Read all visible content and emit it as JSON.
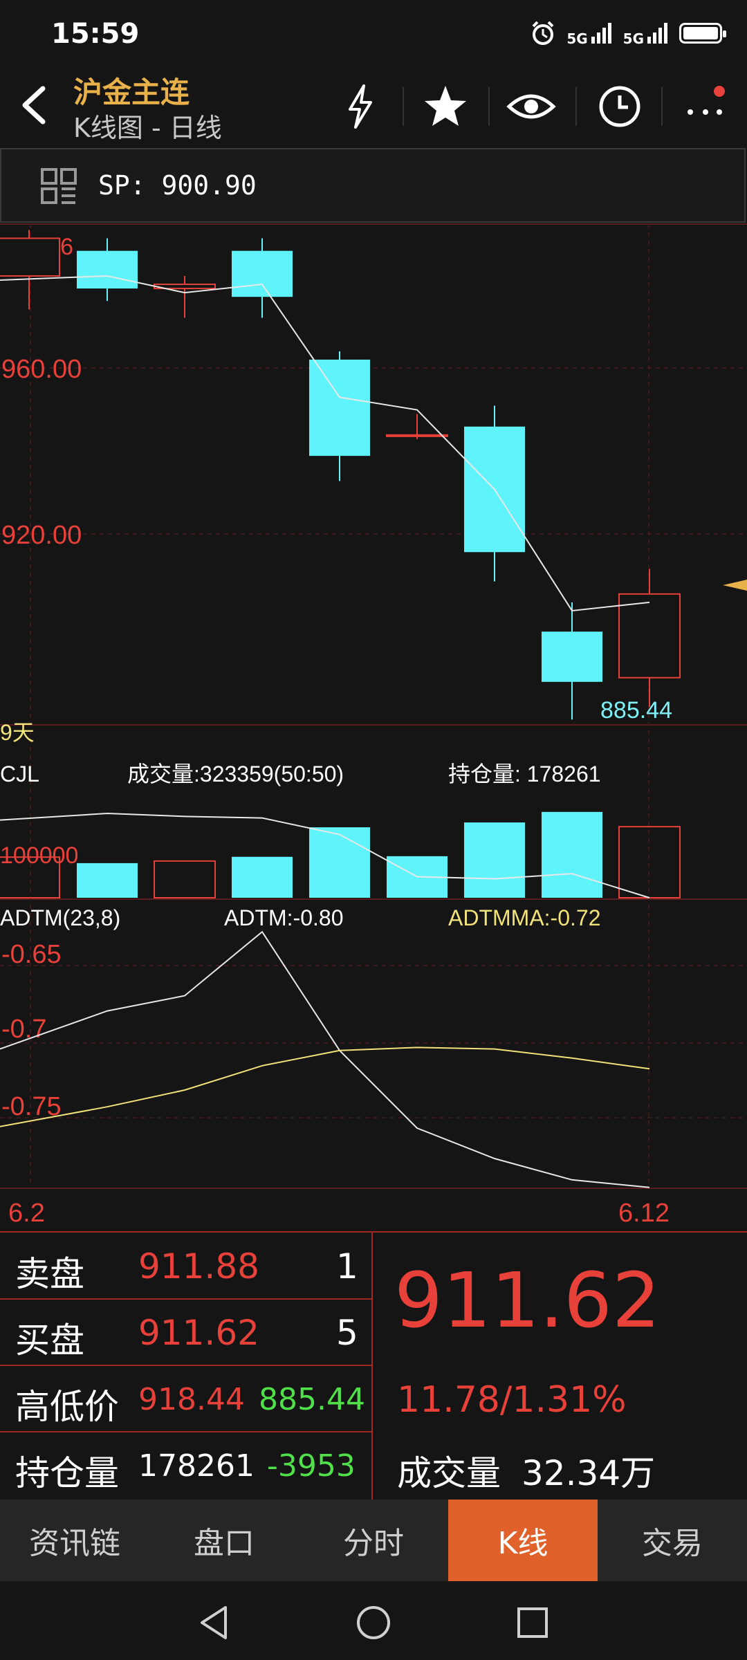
{
  "status_bar": {
    "time": "15:59",
    "signal1": "5G",
    "signal2": "5G"
  },
  "header": {
    "title": "沪金主连",
    "subtitle": "K线图 - 日线",
    "icons": [
      "back-icon",
      "lightning-icon",
      "star-icon",
      "eye-icon",
      "clock-icon",
      "more-icon"
    ]
  },
  "sp": {
    "label": "SP: 900.90"
  },
  "kline": {
    "y_labels": [
      "990.96",
      "960.00",
      "920.00"
    ],
    "low_label": "885.44",
    "period_label": "9天",
    "candles": [
      {
        "open": 981,
        "close": 990,
        "high": 992,
        "low": 973
      },
      {
        "open": 987,
        "close": 978,
        "high": 990,
        "low": 975
      },
      {
        "open": 978,
        "close": 979,
        "high": 981,
        "low": 971
      },
      {
        "open": 987,
        "close": 976,
        "high": 990,
        "low": 971
      },
      {
        "open": 961,
        "close": 938,
        "high": 963,
        "low": 932
      },
      {
        "open": 943,
        "close": 943,
        "high": 948,
        "low": 942
      },
      {
        "open": 945,
        "close": 915,
        "high": 950,
        "low": 908
      },
      {
        "open": 896,
        "close": 884,
        "high": 903,
        "low": 875
      },
      {
        "open": 885,
        "close": 905,
        "high": 911,
        "low": 878
      }
    ],
    "ma": [
      980,
      981,
      977,
      979,
      952,
      949,
      930,
      901,
      903
    ]
  },
  "volume": {
    "title": "CJL",
    "volume_text": "成交量:323359(50:50)",
    "oi_text": "持仓量: 178261",
    "scale_label": "100000",
    "bars": [
      {
        "v": 135000,
        "up": true
      },
      {
        "v": 115000,
        "up": false
      },
      {
        "v": 122000,
        "up": true
      },
      {
        "v": 136000,
        "up": false
      },
      {
        "v": 234000,
        "up": false
      },
      {
        "v": 138000,
        "up": false
      },
      {
        "v": 250000,
        "up": false
      },
      {
        "v": 285000,
        "up": false
      },
      {
        "v": 236000,
        "up": true
      }
    ],
    "oi_line": [
      258000,
      280000,
      270000,
      265000,
      210000,
      70000,
      63000,
      80000,
      0
    ]
  },
  "adtm": {
    "title": "ADTM(23,8)",
    "adtm_text": "ADTM:-0.80",
    "adtmma_text": "ADTMMA:-0.72",
    "y_labels": [
      "-0.65",
      "-0.7",
      "-0.75"
    ],
    "adtm": [
      -0.713,
      -0.688,
      -0.678,
      -0.636,
      -0.714,
      -0.765,
      -0.785,
      -0.799,
      -0.804
    ],
    "adtmma": [
      -0.764,
      -0.751,
      -0.74,
      -0.724,
      -0.714,
      -0.712,
      -0.713,
      -0.719,
      -0.726
    ]
  },
  "dates": {
    "start": "6.2",
    "end": "6.12"
  },
  "quote": {
    "sell_label": "卖盘",
    "sell_price": "911.88",
    "sell_qty": "1",
    "buy_label": "买盘",
    "buy_price": "911.62",
    "buy_qty": "5",
    "hl_label": "高低价",
    "high": "918.44",
    "low": "885.44",
    "oi_label": "持仓量",
    "oi_value": "178261",
    "oi_change": "-3953",
    "last_price": "911.62",
    "change": "11.78/1.31%",
    "vol_label": "成交量",
    "vol_value": "32.34万"
  },
  "tabs": [
    {
      "label": "资讯链",
      "active": false
    },
    {
      "label": "盘口",
      "active": false
    },
    {
      "label": "分时",
      "active": false
    },
    {
      "label": "K线",
      "active": true
    },
    {
      "label": "交易",
      "active": false
    }
  ],
  "colors": {
    "up": "#e8413a",
    "down": "#5ff4fb",
    "ma": "#e8e8e8",
    "adtmma": "#f2e27a",
    "title": "#e9b14a",
    "active_tab": "#e0622a"
  }
}
